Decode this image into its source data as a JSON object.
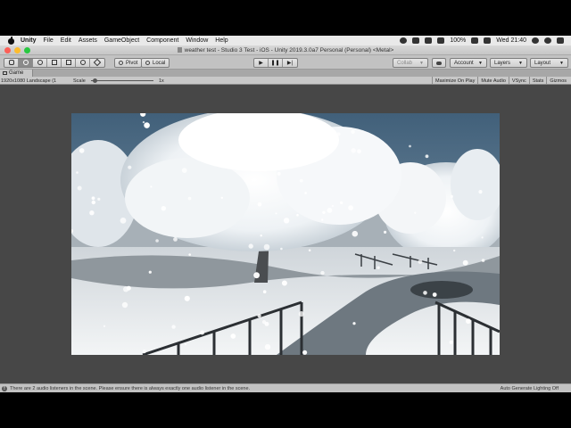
{
  "menubar": {
    "app_name": "Unity",
    "items": [
      "File",
      "Edit",
      "Assets",
      "GameObject",
      "Component",
      "Window",
      "Help"
    ],
    "battery": "100%",
    "clock": "Wed 21:40"
  },
  "window": {
    "title": "weather test - Studio 3 Test - iOS - Unity 2019.3.0a7 Personal (Personal) <Metal>"
  },
  "toolbar": {
    "pivot_label": "Pivot",
    "local_label": "Local",
    "collab_label": "Collab",
    "account_label": "Account",
    "layers_label": "Layers",
    "layout_label": "Layout"
  },
  "game_tab": {
    "label": "Game"
  },
  "game_view": {
    "resolution": "1920x1080 Landscape (1",
    "scale_label": "Scale",
    "scale_value": "1x",
    "scale_fraction": 0.05,
    "toggles": [
      "Maximize On Play",
      "Mute Audio",
      "VSync",
      "Stats",
      "Gizmos"
    ]
  },
  "status": {
    "message": "There are 2 audio listeners in the scene. Please ensure there is always exactly one audio listener in the scene.",
    "right_text": "Auto Generate Lighting Off"
  }
}
